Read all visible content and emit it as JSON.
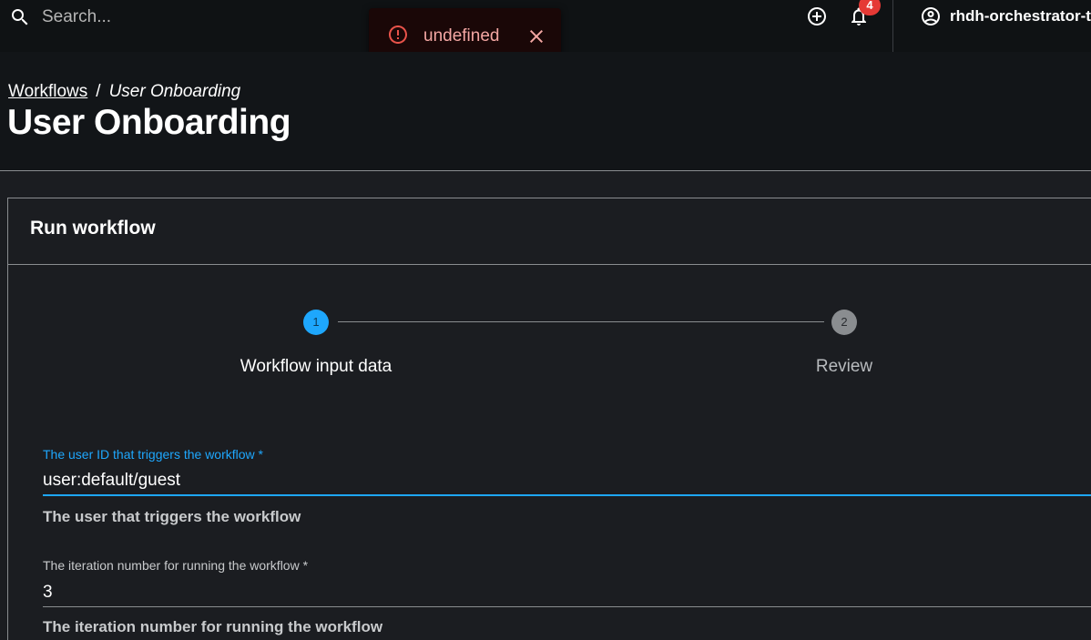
{
  "topbar": {
    "search_placeholder": "Search...",
    "notification_count": "4",
    "profile_name": "rhdh-orchestrator-t"
  },
  "toast": {
    "message": "undefined"
  },
  "header": {
    "breadcrumb_link": "Workflows",
    "breadcrumb_separator": "/",
    "breadcrumb_current": "User Onboarding",
    "title": "User Onboarding"
  },
  "card": {
    "title": "Run workflow"
  },
  "stepper": {
    "steps": [
      {
        "number": "1",
        "label": "Workflow input data"
      },
      {
        "number": "2",
        "label": "Review"
      }
    ]
  },
  "form": {
    "fields": [
      {
        "label": "The user ID that triggers the workflow *",
        "value": "user:default/guest",
        "helper": "The user that triggers the workflow"
      },
      {
        "label": "The iteration number for running the workflow *",
        "value": "3",
        "helper": "The iteration number for running the workflow"
      }
    ]
  },
  "colors": {
    "accent": "#1ea7fd",
    "error": "#e53935",
    "background": "#1b1d21"
  }
}
